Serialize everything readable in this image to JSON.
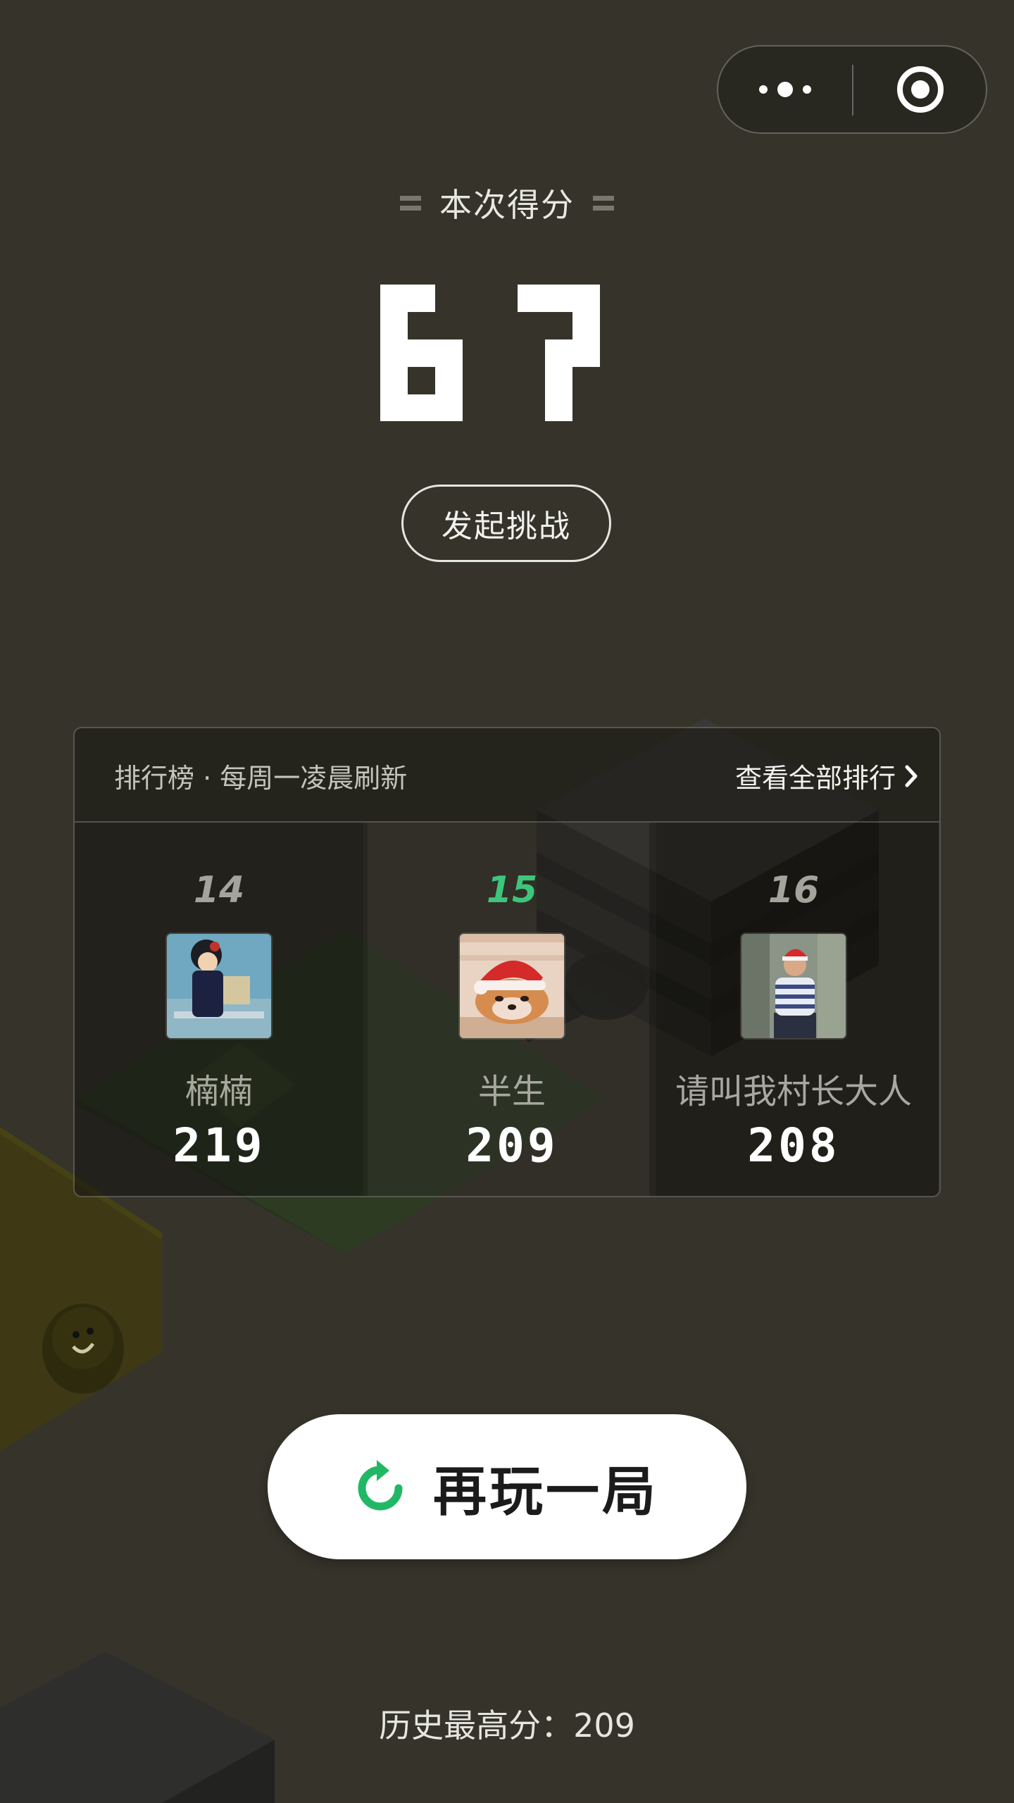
{
  "capsule": {
    "more_icon": "more-dots-icon",
    "close_icon": "target-close-icon"
  },
  "score": {
    "title": "本次得分",
    "value": "67"
  },
  "challenge": {
    "label": "发起挑战"
  },
  "leaderboard": {
    "title": "排行榜 · 每周一凌晨刷新",
    "view_all": "查看全部排行",
    "view_all_icon": "chevron-right-icon",
    "entries": [
      {
        "rank": "14",
        "name": "楠楠",
        "score": "219",
        "is_me": false
      },
      {
        "rank": "15",
        "name": "半生",
        "score": "209",
        "is_me": true
      },
      {
        "rank": "16",
        "name": "请叫我村长大人",
        "score": "208",
        "is_me": false
      }
    ]
  },
  "replay": {
    "label": "再玩一局",
    "icon": "replay-arrow-icon"
  },
  "history": {
    "text": "历史最高分：209"
  },
  "colors": {
    "background": "#35332a",
    "accent_green": "#3ec57b"
  }
}
